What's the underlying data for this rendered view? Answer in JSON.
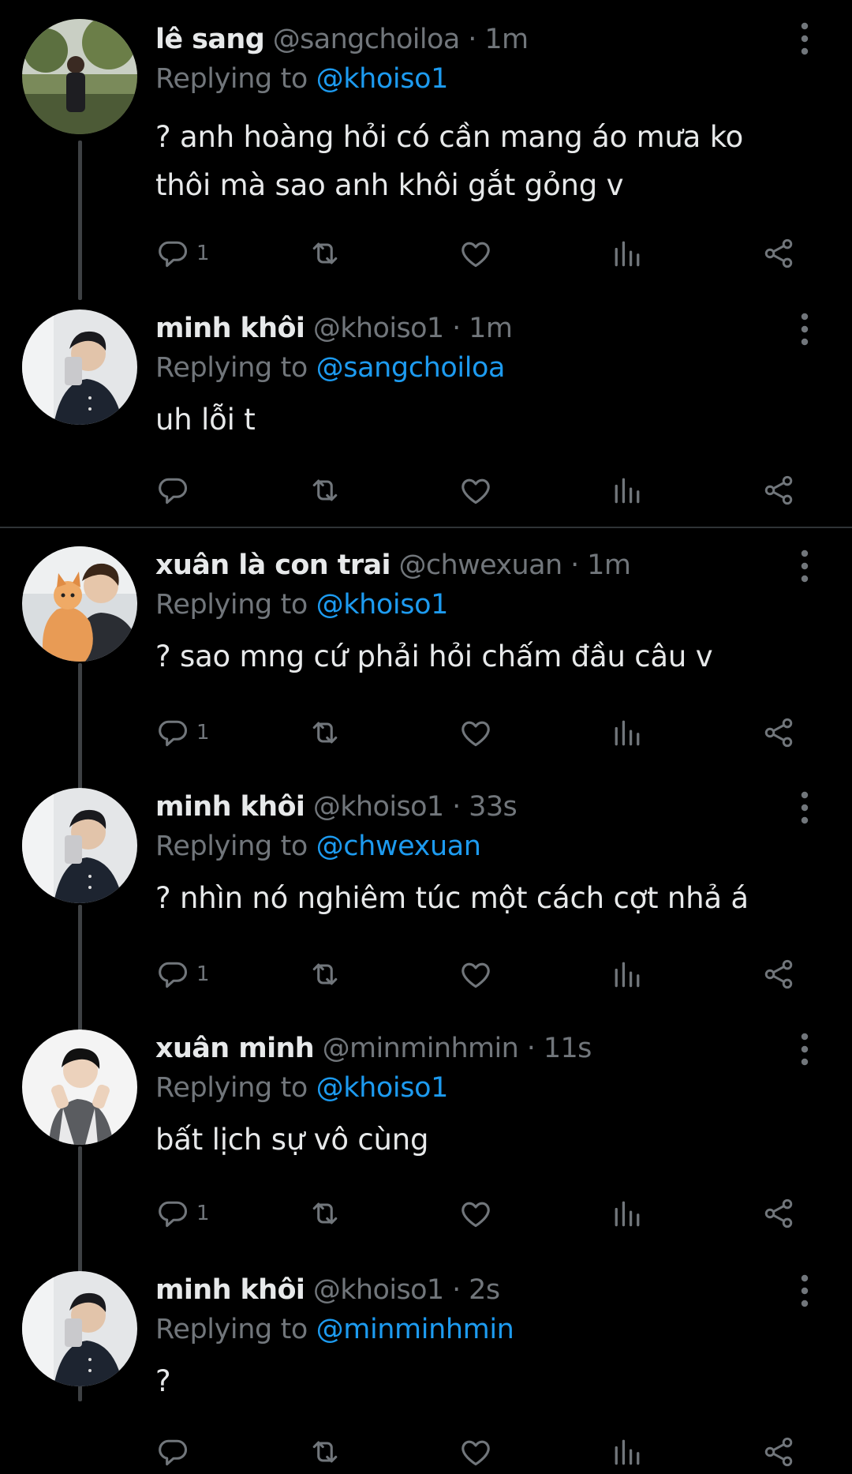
{
  "tweets": [
    {
      "name": "lê sang",
      "handle": "@sangchoiloa",
      "dot": "·",
      "time": "1m",
      "replying_prefix": "Replying to",
      "replying_to": "@khoiso1",
      "text": "? anh hoàng hỏi có cần mang áo mưa ko thôi mà sao anh khôi gắt gỏng v",
      "reply_count": "1"
    },
    {
      "name": "minh khôi",
      "handle": "@khoiso1",
      "dot": "·",
      "time": "1m",
      "replying_prefix": "Replying to",
      "replying_to": "@sangchoiloa",
      "text": "uh lỗi t",
      "reply_count": ""
    },
    {
      "name": "xuân là con trai",
      "handle": "@chwexuan",
      "dot": "·",
      "time": "1m",
      "replying_prefix": "Replying to",
      "replying_to": "@khoiso1",
      "text": "? sao mng cứ phải hỏi chấm đầu câu v",
      "reply_count": "1"
    },
    {
      "name": "minh khôi",
      "handle": "@khoiso1",
      "dot": "·",
      "time": "33s",
      "replying_prefix": "Replying to",
      "replying_to": "@chwexuan",
      "text": "? nhìn nó nghiêm túc một cách cợt nhả á",
      "reply_count": "1"
    },
    {
      "name": "xuân minh",
      "handle": "@minminhmin",
      "dot": "·",
      "time": "11s",
      "replying_prefix": "Replying to",
      "replying_to": "@khoiso1",
      "text": "bất lịch sự vô cùng",
      "reply_count": "1"
    },
    {
      "name": "minh khôi",
      "handle": "@khoiso1",
      "dot": "·",
      "time": "2s",
      "replying_prefix": "Replying to",
      "replying_to": "@minminhmin",
      "text": "?",
      "reply_count": ""
    }
  ],
  "icons": {
    "reply": "reply-icon",
    "retweet": "retweet-icon",
    "like": "like-icon",
    "views": "views-icon",
    "share": "share-icon",
    "more": "more-options-icon"
  },
  "colors": {
    "background": "#000000",
    "text": "#e7e9ea",
    "muted": "#71767b",
    "mention": "#1d9bf0",
    "thread_line": "#3e4144",
    "separator": "#2f3336"
  }
}
